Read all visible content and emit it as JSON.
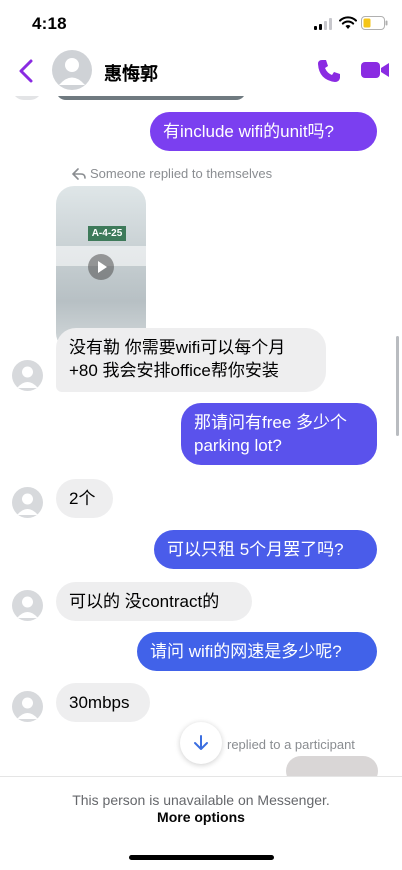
{
  "status": {
    "time": "4:18"
  },
  "header": {
    "contact_name": "惠悔郭"
  },
  "messages": {
    "m1": "有include wifi的unit吗?",
    "reply_note": "Someone replied to themselves",
    "video_sign": "A-4-25",
    "m2": "没有勒 你需要wifi可以每个月+80 我会安排office帮你安装",
    "m3": "那请问有free 多少个parking lot?",
    "m4": "2个",
    "m5": "可以只租 5个月罢了吗?",
    "m6": "可以的 没contract的",
    "m7": "请问 wifi的网速是多少呢?",
    "m8": "30mbps",
    "replied_note": "replied to a participant"
  },
  "footer": {
    "unavailable_text": "This person is unavailable on Messenger.",
    "more_options": "More options"
  },
  "colors": {
    "accent_purple": "#8a2be2",
    "bubble_top": "#7d3bf0",
    "bubble_bottom": "#3f62e8",
    "incoming_bubble": "#eeeeef"
  },
  "icons": {
    "back": "chevron-left-icon",
    "call": "phone-icon",
    "video": "video-camera-icon",
    "scroll": "arrow-down-icon",
    "reply": "reply-arrow-icon"
  }
}
